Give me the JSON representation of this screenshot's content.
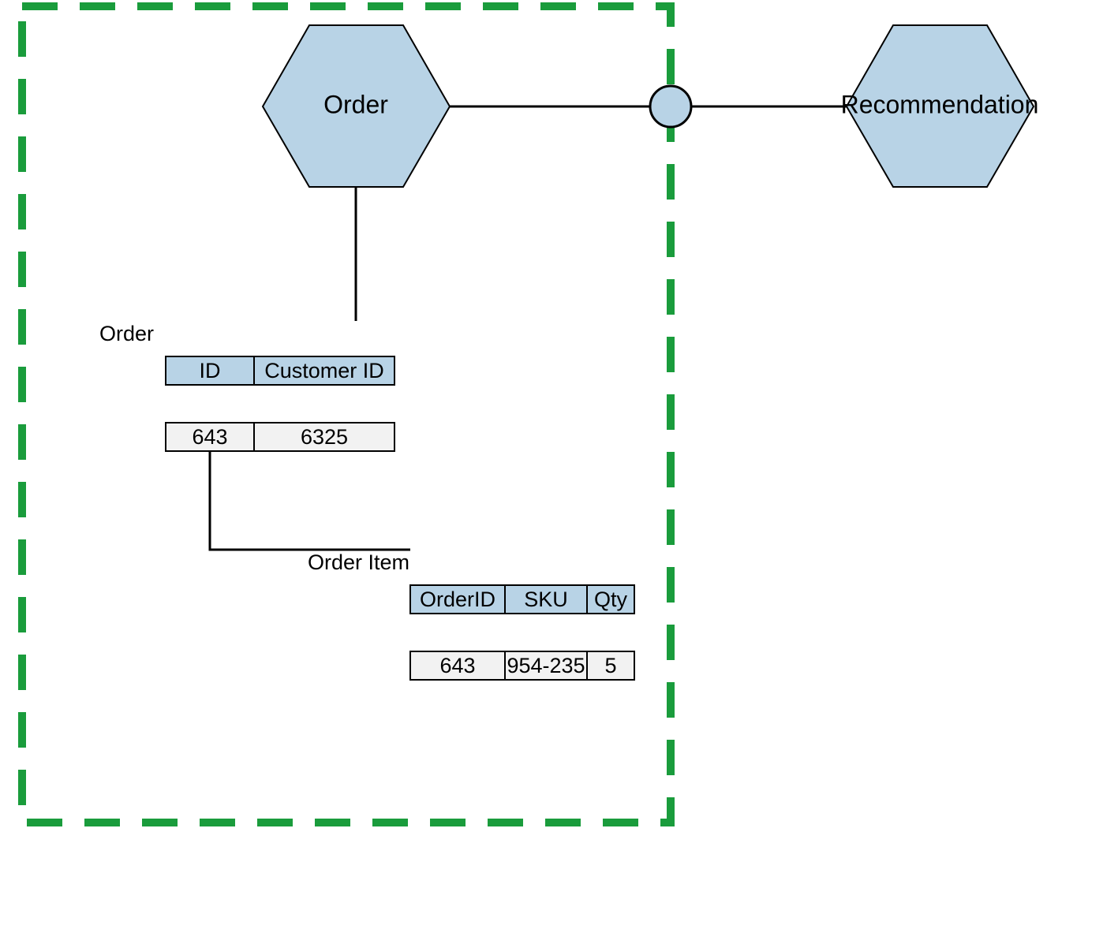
{
  "services": {
    "order": "Order",
    "recommendation": "Recommendation"
  },
  "order_table": {
    "name": "Order",
    "headers": {
      "id": "ID",
      "customer_id": "Customer ID"
    },
    "row": {
      "id": "643",
      "customer_id": "6325"
    }
  },
  "order_item_table": {
    "name": "Order Item",
    "headers": {
      "order_id": "OrderID",
      "sku": "SKU",
      "qty": "Qty"
    },
    "row": {
      "order_id": "643",
      "sku": "954-235",
      "qty": "5"
    }
  }
}
